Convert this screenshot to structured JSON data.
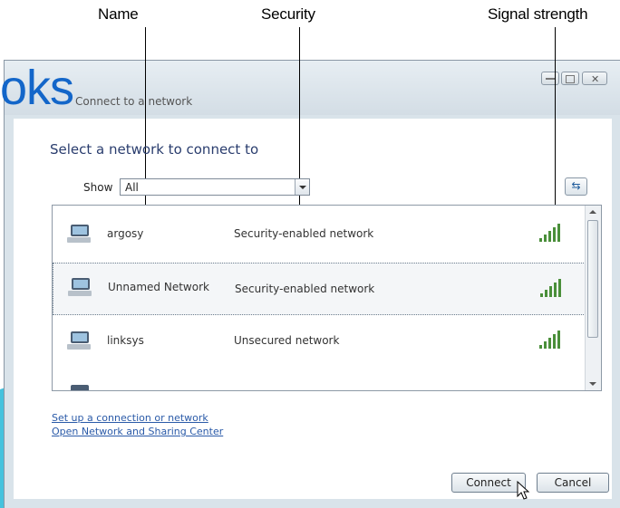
{
  "callouts": {
    "name": "Name",
    "security": "Security",
    "signal": "Signal strength"
  },
  "logo_fragment": "oks",
  "window": {
    "title": "Connect to a network",
    "heading": "Select a network to connect to"
  },
  "filter": {
    "label": "Show",
    "selected": "All"
  },
  "networks": [
    {
      "name": "argosy",
      "security": "Security-enabled network",
      "signal_bars": 5
    },
    {
      "name": "Unnamed Network",
      "security": "Security-enabled network",
      "signal_bars": 5,
      "selected": true
    },
    {
      "name": "linksys",
      "security": "Unsecured network",
      "signal_bars": 5
    }
  ],
  "links": {
    "setup": "Set up a connection or network",
    "sharing_center": "Open Network and Sharing Center"
  },
  "buttons": {
    "connect": "Connect",
    "cancel": "Cancel"
  },
  "icons": {
    "window_controls": [
      "minimize-icon",
      "maximize-icon",
      "close-icon"
    ],
    "refresh": "refresh-icon",
    "network": "network-adapter-icon",
    "signal": "signal-strength-icon",
    "cursor": "mouse-pointer-icon"
  },
  "colors": {
    "logo": "#1366c9",
    "heading": "#2a3d6e",
    "link": "#2a5aa8",
    "background_wave": "#45c2dd",
    "background_accent": "#e0464f"
  }
}
